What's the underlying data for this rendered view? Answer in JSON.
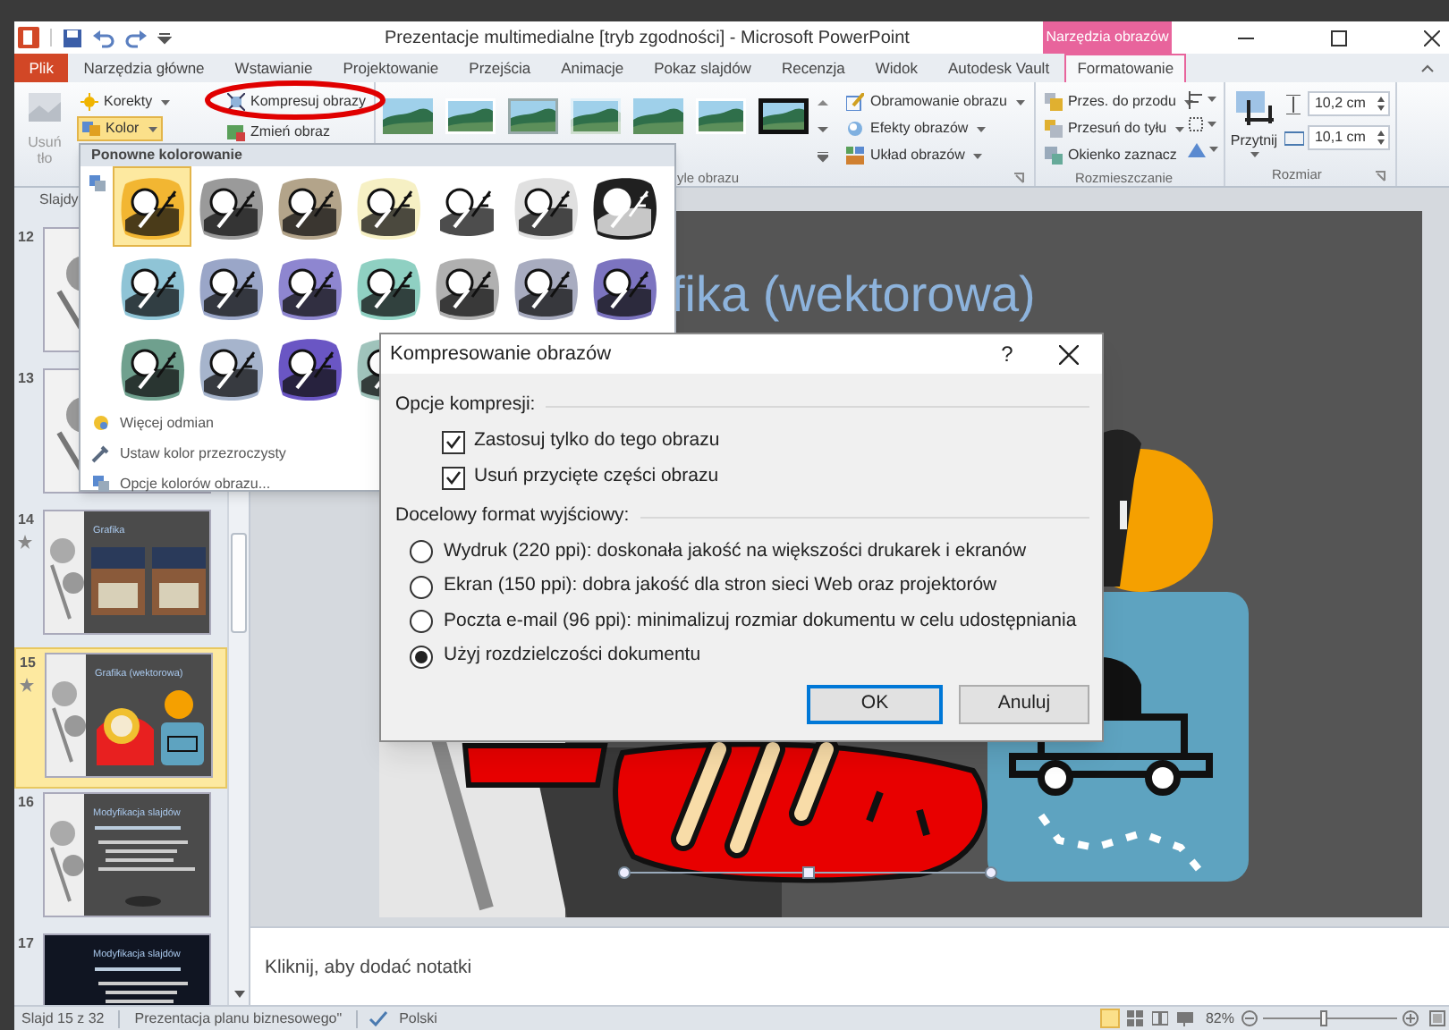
{
  "window": {
    "title": "Prezentacje multimedialne [tryb zgodności] - Microsoft PowerPoint",
    "contextual_group": "Narzędzia obrazów"
  },
  "tabs": [
    {
      "label": "Plik",
      "kind": "file",
      "selected": false
    },
    {
      "label": "Narzędzia główne",
      "kind": "tab",
      "selected": false
    },
    {
      "label": "Wstawianie",
      "kind": "tab",
      "selected": false
    },
    {
      "label": "Projektowanie",
      "kind": "tab",
      "selected": false
    },
    {
      "label": "Przejścia",
      "kind": "tab",
      "selected": false
    },
    {
      "label": "Animacje",
      "kind": "tab",
      "selected": false
    },
    {
      "label": "Pokaz slajdów",
      "kind": "tab",
      "selected": false
    },
    {
      "label": "Recenzja",
      "kind": "tab",
      "selected": false
    },
    {
      "label": "Widok",
      "kind": "tab",
      "selected": false
    },
    {
      "label": "Autodesk Vault",
      "kind": "tab",
      "selected": false
    },
    {
      "label": "Formatowanie",
      "kind": "contextual",
      "selected": true
    }
  ],
  "ribbon": {
    "remove_background": {
      "label": "Usuń tło",
      "disabled": true
    },
    "adjust": [
      {
        "label": "Korekty",
        "selected": false
      },
      {
        "label": "Kolor",
        "selected": true
      }
    ],
    "picture_tools": [
      "Kompresuj obrazy",
      "Zmień obraz"
    ],
    "style_gallery": [
      {
        "kind": "plain"
      },
      {
        "kind": "white-frame"
      },
      {
        "kind": "gray-frame"
      },
      {
        "kind": "soft"
      },
      {
        "kind": "plain"
      },
      {
        "kind": "white-frame"
      },
      {
        "kind": "black-frame"
      }
    ],
    "styles_label": "yle obrazu",
    "picture_format": [
      "Obramowanie obrazu",
      "Efekty obrazów",
      "Układ obrazów"
    ],
    "arrange": {
      "label": "Rozmieszczanie",
      "items": [
        "Przes. do przodu",
        "Przesuń do tyłu",
        "Okienko zaznacz"
      ]
    },
    "size": {
      "label": "Rozmiar",
      "crop": "Przytnij",
      "height": "10,2 cm",
      "width": "10,1 cm"
    }
  },
  "color_menu": {
    "header": "Ponowne kolorowanie",
    "options": [
      {
        "color": "#f2b632",
        "selected": true
      },
      {
        "color": "#9a9a9a",
        "selected": false
      },
      {
        "color": "#b3a48a",
        "selected": false
      },
      {
        "color": "#f6f0c4",
        "selected": false
      },
      {
        "color": "#ffffff",
        "selected": false
      },
      {
        "color": "#e0e0e0",
        "selected": false
      },
      {
        "color": "#202020",
        "selected": false
      },
      {
        "color": "#8fc4d6",
        "selected": false
      },
      {
        "color": "#9aa6c8",
        "selected": false
      },
      {
        "color": "#8e86d0",
        "selected": false
      },
      {
        "color": "#8fd0c2",
        "selected": false
      },
      {
        "color": "#b0b0b0",
        "selected": false
      },
      {
        "color": "#a8acc0",
        "selected": false
      },
      {
        "color": "#7c74c0",
        "selected": false
      },
      {
        "color": "#6fa08e",
        "selected": false
      },
      {
        "color": "#a6b4cc",
        "selected": false
      },
      {
        "color": "#6a56c4",
        "selected": false
      },
      {
        "color": "#a0c4bc",
        "selected": false
      }
    ],
    "items": [
      "Więcej odmian",
      "Ustaw kolor przezroczysty",
      "Opcje kolorów obrazu..."
    ]
  },
  "slides_panel": {
    "tab": "Slajdy",
    "slides": [
      {
        "number": "12",
        "kind": "gray-balls",
        "animated": false,
        "selected": false
      },
      {
        "number": "13",
        "kind": "gray-balls",
        "animated": false,
        "selected": false
      },
      {
        "number": "14",
        "kind": "photos",
        "title": "Grafika",
        "animated": true,
        "selected": false
      },
      {
        "number": "15",
        "kind": "clipart",
        "title": "Grafika (wektorowa)",
        "animated": true,
        "selected": true
      },
      {
        "number": "16",
        "kind": "bullets",
        "title": "Modyfikacja slajdów",
        "animated": false,
        "selected": false
      },
      {
        "number": "17",
        "kind": "night",
        "title": "Modyfikacja slajdów",
        "animated": false,
        "selected": false
      }
    ]
  },
  "slide": {
    "title": "fika (wektorowa)"
  },
  "notes": {
    "placeholder": "Kliknij, aby dodać notatki"
  },
  "dialog": {
    "title": "Kompresowanie obrazów",
    "help": "?",
    "options_label": "Opcje kompresji:",
    "checkboxes": [
      {
        "label": "Zastosuj tylko do tego obrazu",
        "checked": true
      },
      {
        "label": "Usuń przycięte części obrazu",
        "checked": true
      }
    ],
    "format_label": "Docelowy format wyjściowy:",
    "radios": [
      {
        "label": "Wydruk (220 ppi): doskonała jakość na większości drukarek i ekranów",
        "selected": false
      },
      {
        "label": "Ekran (150 ppi): dobra jakość dla stron sieci Web oraz projektorów",
        "selected": false
      },
      {
        "label": "Poczta e-mail (96 ppi): minimalizuj rozmiar dokumentu w celu udostępniania",
        "selected": false
      },
      {
        "label": "Użyj rozdzielczości dokumentu",
        "selected": true
      }
    ],
    "buttons": [
      {
        "label": "OK",
        "default": true
      },
      {
        "label": "Anuluj",
        "default": false
      }
    ]
  },
  "status_bar": {
    "slide": "Slajd 15 z 32",
    "theme": "Prezentacja planu biznesowego\"",
    "language": "Polski",
    "zoom": "82%",
    "zoom_slider": {
      "level": 0.45
    }
  }
}
